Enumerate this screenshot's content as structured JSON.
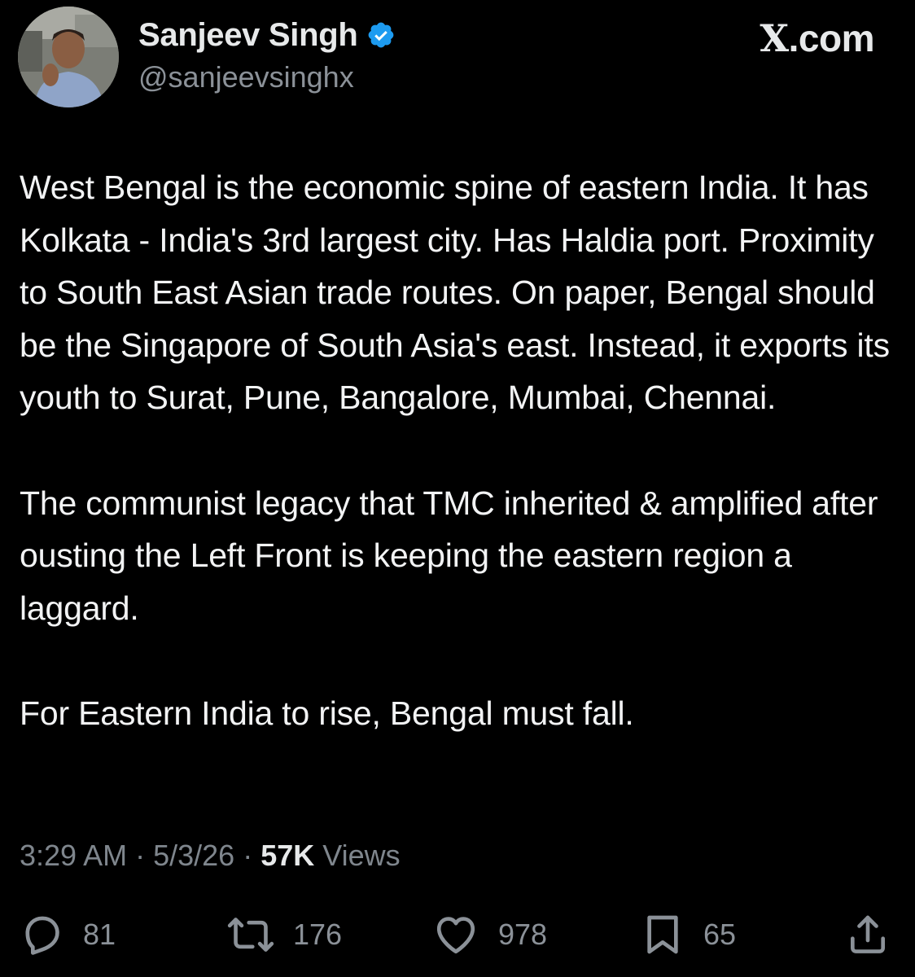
{
  "author": {
    "display_name": "Sanjeev Singh",
    "handle": "@sanjeevsinghx",
    "verified_color": "#1d9bf0"
  },
  "source": {
    "x_letter": "X",
    "domain": ".com"
  },
  "tweet": {
    "paragraphs": [
      "West Bengal is the economic spine of eastern India. It has Kolkata - India's 3rd largest city. Has Haldia port. Proximity to South East Asian trade routes. On paper, Bengal should be the Singapore of South Asia's east. Instead, it exports its youth to Surat, Pune, Bangalore, Mumbai, Chennai.",
      "The communist legacy that TMC inherited & amplified after ousting the Left Front is keeping the eastern region a laggard.",
      "For Eastern India to rise, Bengal must fall."
    ]
  },
  "meta": {
    "time": "3:29 AM",
    "separator": " · ",
    "date": "5/3/26",
    "views_count": "57K",
    "views_label": " Views"
  },
  "actions": {
    "replies": "81",
    "reposts": "176",
    "likes": "978",
    "bookmarks": "65",
    "icons": [
      "reply-icon",
      "repost-icon",
      "like-icon",
      "bookmark-icon",
      "share-icon"
    ]
  },
  "colors": {
    "background": "#000000",
    "primary_text": "#e7e9ea",
    "secondary_text": "#8b9198"
  }
}
